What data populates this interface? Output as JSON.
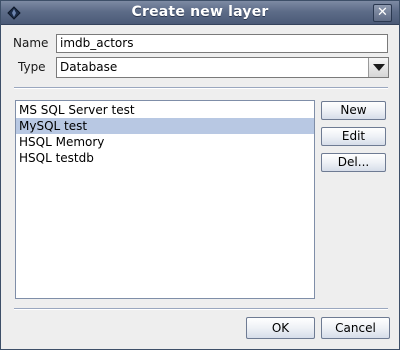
{
  "window": {
    "title": "Create new layer"
  },
  "form": {
    "name_label": "Name",
    "name_value": "imdb_actors",
    "type_label": "Type",
    "type_value": "Database"
  },
  "connections": {
    "items": [
      "MS SQL Server test",
      "MySQL test",
      "HSQL Memory",
      "HSQL testdb"
    ],
    "selected_index": 1,
    "new_label": "New",
    "edit_label": "Edit",
    "delete_label": "Del..."
  },
  "footer": {
    "ok_label": "OK",
    "cancel_label": "Cancel"
  },
  "colors": {
    "title_bar": "#5d6c88",
    "selection": "#b8c8e3",
    "dialog_bg": "#eeeeee"
  },
  "icons": {
    "window": "diamond-app-icon",
    "close": "close-icon",
    "dropdown": "chevron-down-icon"
  }
}
